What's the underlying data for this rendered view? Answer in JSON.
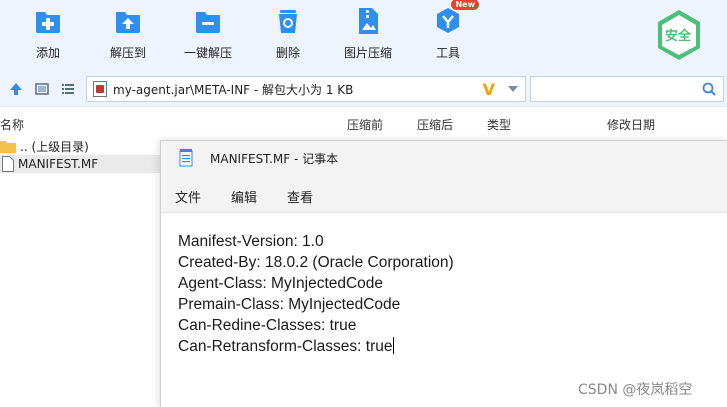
{
  "toolbar": {
    "buttons": [
      {
        "label": "添加",
        "icon": "add-icon"
      },
      {
        "label": "解压到",
        "icon": "extract-to-icon"
      },
      {
        "label": "一键解压",
        "icon": "one-click-extract-icon"
      },
      {
        "label": "删除",
        "icon": "delete-icon"
      },
      {
        "label": "图片压缩",
        "icon": "image-compress-icon"
      },
      {
        "label": "工具",
        "icon": "tools-icon",
        "badge": "New"
      }
    ],
    "safe_badge": "安全"
  },
  "address_bar": {
    "path": "my-agent.jar\\META-INF - 解包大小为 1 KB",
    "brand_glyph": "V"
  },
  "file_list": {
    "columns": [
      "名称",
      "压缩前",
      "压缩后",
      "类型",
      "修改日期"
    ],
    "rows": [
      {
        "name": ".. (上级目录)",
        "icon": "folder-icon"
      },
      {
        "name": "MANIFEST.MF",
        "icon": "file-icon",
        "selected": true
      }
    ]
  },
  "notepad": {
    "title": "MANIFEST.MF - 记事本",
    "menu": [
      "文件",
      "编辑",
      "查看"
    ],
    "lines": [
      "Manifest-Version: 1.0",
      "Created-By: 18.0.2 (Oracle Corporation)",
      "Agent-Class: MyInjectedCode",
      "Premain-Class: MyInjectedCode",
      "Can-Redine-Classes: true",
      "Can-Retransform-Classes: true"
    ]
  },
  "watermark": "CSDN @夜岚稻空",
  "colors": {
    "toolbar_bg": "#eef4fd",
    "icon_blue": "#2f8ff0",
    "badge_red": "#e8432e",
    "safe_green": "#4cbf7a"
  }
}
